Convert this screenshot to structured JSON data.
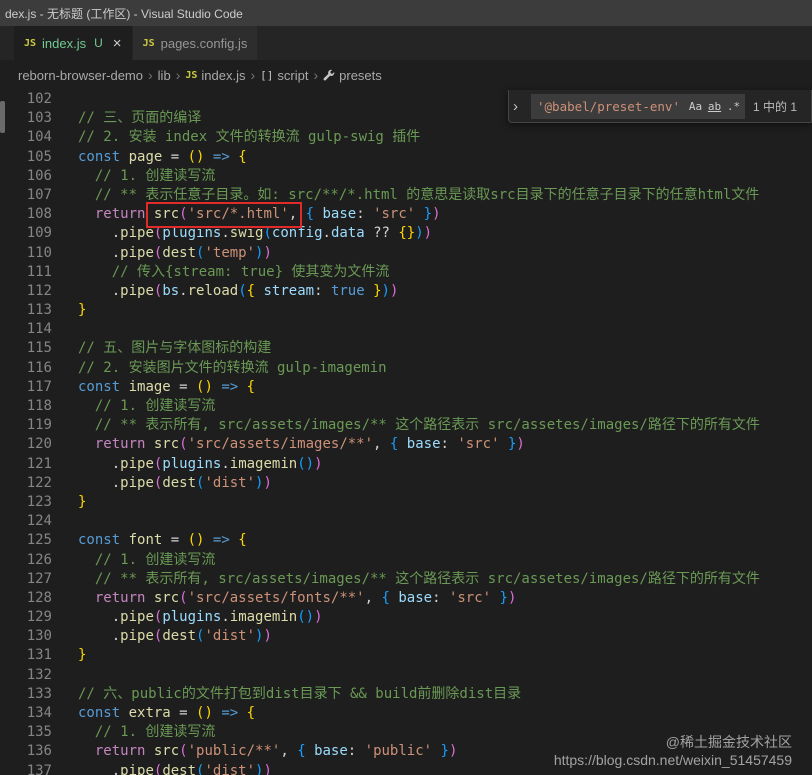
{
  "window": {
    "title": "dex.js - 无标题 (工作区) - Visual Studio Code"
  },
  "icons": {
    "js_file": "JS",
    "close": "×",
    "chevron_right": "›",
    "breadcrumb_separator": "›",
    "script_symbol": "[]"
  },
  "tabs": [
    {
      "label": "index.js",
      "badge": "U"
    },
    {
      "label": "pages.config.js",
      "badge": ""
    }
  ],
  "breadcrumb": [
    "reborn-browser-demo",
    "lib",
    "index.js",
    "script",
    "presets"
  ],
  "find": {
    "query": "'@babel/preset-env'",
    "match_case": "Aa",
    "whole_word": "ab",
    "regex": ".*",
    "results": "1 中的 1"
  },
  "watermark": {
    "line1": "@稀土掘金技术社区",
    "line2": "https://blog.csdn.net/weixin_51457459"
  },
  "colors": {
    "comment_green": "#6A9955",
    "keyword_blue": "#569CD6",
    "control_purple": "#C586C0",
    "function_yellow": "#DCDCAA",
    "variable_blue": "#9CDCFE",
    "string_orange": "#CE9178",
    "modified_tab_green": "#73C991",
    "annotation_red": "#E02B2B"
  },
  "editor": {
    "lines": [
      {
        "n": 102,
        "t": []
      },
      {
        "n": 103,
        "t": [
          [
            "// 三、页面的编译",
            "c"
          ]
        ]
      },
      {
        "n": 104,
        "t": [
          [
            "// 2. 安装 index 文件的转换流 gulp-swig 插件",
            "c"
          ]
        ]
      },
      {
        "n": 105,
        "t": [
          [
            "const",
            "k"
          ],
          [
            " ",
            "d"
          ],
          [
            "page",
            "f"
          ],
          [
            " = ",
            "d"
          ],
          [
            "()",
            "b1"
          ],
          [
            " ",
            "d"
          ],
          [
            "=>",
            "k"
          ],
          [
            " ",
            "d"
          ],
          [
            "{",
            "b1"
          ]
        ]
      },
      {
        "n": 106,
        "t": [
          [
            "  // 1. 创建读写流",
            "c"
          ]
        ]
      },
      {
        "n": 107,
        "t": [
          [
            "  // ** 表示任意子目录。如: src/**/*.html 的意思是读取src目录下的任意子目录下的任意html文件",
            "c"
          ]
        ]
      },
      {
        "n": 108,
        "t": [
          [
            "  ",
            "d"
          ],
          [
            "return",
            "r"
          ],
          [
            " ",
            "d"
          ],
          [
            "src",
            "f"
          ],
          [
            "(",
            "b2"
          ],
          [
            "'src/*.html'",
            "s"
          ],
          [
            ", ",
            "d"
          ],
          [
            "{",
            "b3"
          ],
          [
            " ",
            "d"
          ],
          [
            "base",
            "v"
          ],
          [
            ": ",
            "d"
          ],
          [
            "'src'",
            "s"
          ],
          [
            " ",
            "d"
          ],
          [
            "}",
            "b3"
          ],
          [
            ")",
            "b2"
          ]
        ]
      },
      {
        "n": 109,
        "t": [
          [
            "    .",
            "d"
          ],
          [
            "pipe",
            "f"
          ],
          [
            "(",
            "b2"
          ],
          [
            "plugins",
            "v"
          ],
          [
            ".",
            "d"
          ],
          [
            "swig",
            "f"
          ],
          [
            "(",
            "b3"
          ],
          [
            "config",
            "v"
          ],
          [
            ".",
            "d"
          ],
          [
            "data",
            "v"
          ],
          [
            " ?? ",
            "d"
          ],
          [
            "{}",
            "b1"
          ],
          [
            ")",
            "b3"
          ],
          [
            ")",
            "b2"
          ]
        ]
      },
      {
        "n": 110,
        "t": [
          [
            "    .",
            "d"
          ],
          [
            "pipe",
            "f"
          ],
          [
            "(",
            "b2"
          ],
          [
            "dest",
            "f"
          ],
          [
            "(",
            "b3"
          ],
          [
            "'temp'",
            "s"
          ],
          [
            ")",
            "b3"
          ],
          [
            ")",
            "b2"
          ]
        ]
      },
      {
        "n": 111,
        "t": [
          [
            "    // 传入{stream: true} 使其变为文件流",
            "c"
          ]
        ]
      },
      {
        "n": 112,
        "t": [
          [
            "    .",
            "d"
          ],
          [
            "pipe",
            "f"
          ],
          [
            "(",
            "b2"
          ],
          [
            "bs",
            "v"
          ],
          [
            ".",
            "d"
          ],
          [
            "reload",
            "f"
          ],
          [
            "(",
            "b3"
          ],
          [
            "{",
            "b1"
          ],
          [
            " ",
            "d"
          ],
          [
            "stream",
            "v"
          ],
          [
            ": ",
            "d"
          ],
          [
            "true",
            "k"
          ],
          [
            " ",
            "d"
          ],
          [
            "}",
            "b1"
          ],
          [
            ")",
            "b3"
          ],
          [
            ")",
            "b2"
          ]
        ]
      },
      {
        "n": 113,
        "t": [
          [
            "}",
            "b1"
          ]
        ]
      },
      {
        "n": 114,
        "t": []
      },
      {
        "n": 115,
        "t": [
          [
            "// 五、图片与字体图标的构建",
            "c"
          ]
        ]
      },
      {
        "n": 116,
        "t": [
          [
            "// 2. 安装图片文件的转换流 gulp-imagemin",
            "c"
          ]
        ]
      },
      {
        "n": 117,
        "t": [
          [
            "const",
            "k"
          ],
          [
            " ",
            "d"
          ],
          [
            "image",
            "f"
          ],
          [
            " = ",
            "d"
          ],
          [
            "()",
            "b1"
          ],
          [
            " ",
            "d"
          ],
          [
            "=>",
            "k"
          ],
          [
            " ",
            "d"
          ],
          [
            "{",
            "b1"
          ]
        ]
      },
      {
        "n": 118,
        "t": [
          [
            "  // 1. 创建读写流",
            "c"
          ]
        ]
      },
      {
        "n": 119,
        "t": [
          [
            "  // ** 表示所有, src/assets/images/** 这个路径表示 src/assetes/images/路径下的所有文件",
            "c"
          ]
        ]
      },
      {
        "n": 120,
        "t": [
          [
            "  ",
            "d"
          ],
          [
            "return",
            "r"
          ],
          [
            " ",
            "d"
          ],
          [
            "src",
            "f"
          ],
          [
            "(",
            "b2"
          ],
          [
            "'src/assets/images/**'",
            "s"
          ],
          [
            ", ",
            "d"
          ],
          [
            "{",
            "b3"
          ],
          [
            " ",
            "d"
          ],
          [
            "base",
            "v"
          ],
          [
            ": ",
            "d"
          ],
          [
            "'src'",
            "s"
          ],
          [
            " ",
            "d"
          ],
          [
            "}",
            "b3"
          ],
          [
            ")",
            "b2"
          ]
        ]
      },
      {
        "n": 121,
        "t": [
          [
            "    .",
            "d"
          ],
          [
            "pipe",
            "f"
          ],
          [
            "(",
            "b2"
          ],
          [
            "plugins",
            "v"
          ],
          [
            ".",
            "d"
          ],
          [
            "imagemin",
            "f"
          ],
          [
            "()",
            "b3"
          ],
          [
            ")",
            "b2"
          ]
        ]
      },
      {
        "n": 122,
        "t": [
          [
            "    .",
            "d"
          ],
          [
            "pipe",
            "f"
          ],
          [
            "(",
            "b2"
          ],
          [
            "dest",
            "f"
          ],
          [
            "(",
            "b3"
          ],
          [
            "'dist'",
            "s"
          ],
          [
            ")",
            "b3"
          ],
          [
            ")",
            "b2"
          ]
        ]
      },
      {
        "n": 123,
        "t": [
          [
            "}",
            "b1"
          ]
        ]
      },
      {
        "n": 124,
        "t": []
      },
      {
        "n": 125,
        "t": [
          [
            "const",
            "k"
          ],
          [
            " ",
            "d"
          ],
          [
            "font",
            "f"
          ],
          [
            " = ",
            "d"
          ],
          [
            "()",
            "b1"
          ],
          [
            " ",
            "d"
          ],
          [
            "=>",
            "k"
          ],
          [
            " ",
            "d"
          ],
          [
            "{",
            "b1"
          ]
        ]
      },
      {
        "n": 126,
        "t": [
          [
            "  // 1. 创建读写流",
            "c"
          ]
        ]
      },
      {
        "n": 127,
        "t": [
          [
            "  // ** 表示所有, src/assets/images/** 这个路径表示 src/assetes/images/路径下的所有文件",
            "c"
          ]
        ]
      },
      {
        "n": 128,
        "t": [
          [
            "  ",
            "d"
          ],
          [
            "return",
            "r"
          ],
          [
            " ",
            "d"
          ],
          [
            "src",
            "f"
          ],
          [
            "(",
            "b2"
          ],
          [
            "'src/assets/fonts/**'",
            "s"
          ],
          [
            ", ",
            "d"
          ],
          [
            "{",
            "b3"
          ],
          [
            " ",
            "d"
          ],
          [
            "base",
            "v"
          ],
          [
            ": ",
            "d"
          ],
          [
            "'src'",
            "s"
          ],
          [
            " ",
            "d"
          ],
          [
            "}",
            "b3"
          ],
          [
            ")",
            "b2"
          ]
        ]
      },
      {
        "n": 129,
        "t": [
          [
            "    .",
            "d"
          ],
          [
            "pipe",
            "f"
          ],
          [
            "(",
            "b2"
          ],
          [
            "plugins",
            "v"
          ],
          [
            ".",
            "d"
          ],
          [
            "imagemin",
            "f"
          ],
          [
            "()",
            "b3"
          ],
          [
            ")",
            "b2"
          ]
        ]
      },
      {
        "n": 130,
        "t": [
          [
            "    .",
            "d"
          ],
          [
            "pipe",
            "f"
          ],
          [
            "(",
            "b2"
          ],
          [
            "dest",
            "f"
          ],
          [
            "(",
            "b3"
          ],
          [
            "'dist'",
            "s"
          ],
          [
            ")",
            "b3"
          ],
          [
            ")",
            "b2"
          ]
        ]
      },
      {
        "n": 131,
        "t": [
          [
            "}",
            "b1"
          ]
        ]
      },
      {
        "n": 132,
        "t": []
      },
      {
        "n": 133,
        "t": [
          [
            "// 六、public的文件打包到dist目录下 && build前删除dist目录",
            "c"
          ]
        ]
      },
      {
        "n": 134,
        "t": [
          [
            "const",
            "k"
          ],
          [
            " ",
            "d"
          ],
          [
            "extra",
            "f"
          ],
          [
            " = ",
            "d"
          ],
          [
            "()",
            "b1"
          ],
          [
            " ",
            "d"
          ],
          [
            "=>",
            "k"
          ],
          [
            " ",
            "d"
          ],
          [
            "{",
            "b1"
          ]
        ]
      },
      {
        "n": 135,
        "t": [
          [
            "  // 1. 创建读写流",
            "c"
          ]
        ]
      },
      {
        "n": 136,
        "t": [
          [
            "  ",
            "d"
          ],
          [
            "return",
            "r"
          ],
          [
            " ",
            "d"
          ],
          [
            "src",
            "f"
          ],
          [
            "(",
            "b2"
          ],
          [
            "'public/**'",
            "s"
          ],
          [
            ", ",
            "d"
          ],
          [
            "{",
            "b3"
          ],
          [
            " ",
            "d"
          ],
          [
            "base",
            "v"
          ],
          [
            ": ",
            "d"
          ],
          [
            "'public'",
            "s"
          ],
          [
            " ",
            "d"
          ],
          [
            "}",
            "b3"
          ],
          [
            ")",
            "b2"
          ]
        ]
      },
      {
        "n": 137,
        "t": [
          [
            "    .",
            "d"
          ],
          [
            "pipe",
            "f"
          ],
          [
            "(",
            "b2"
          ],
          [
            "dest",
            "f"
          ],
          [
            "(",
            "b3"
          ],
          [
            "'dist'",
            "s"
          ],
          [
            ")",
            "b3"
          ],
          [
            ")",
            "b2"
          ]
        ]
      }
    ]
  }
}
